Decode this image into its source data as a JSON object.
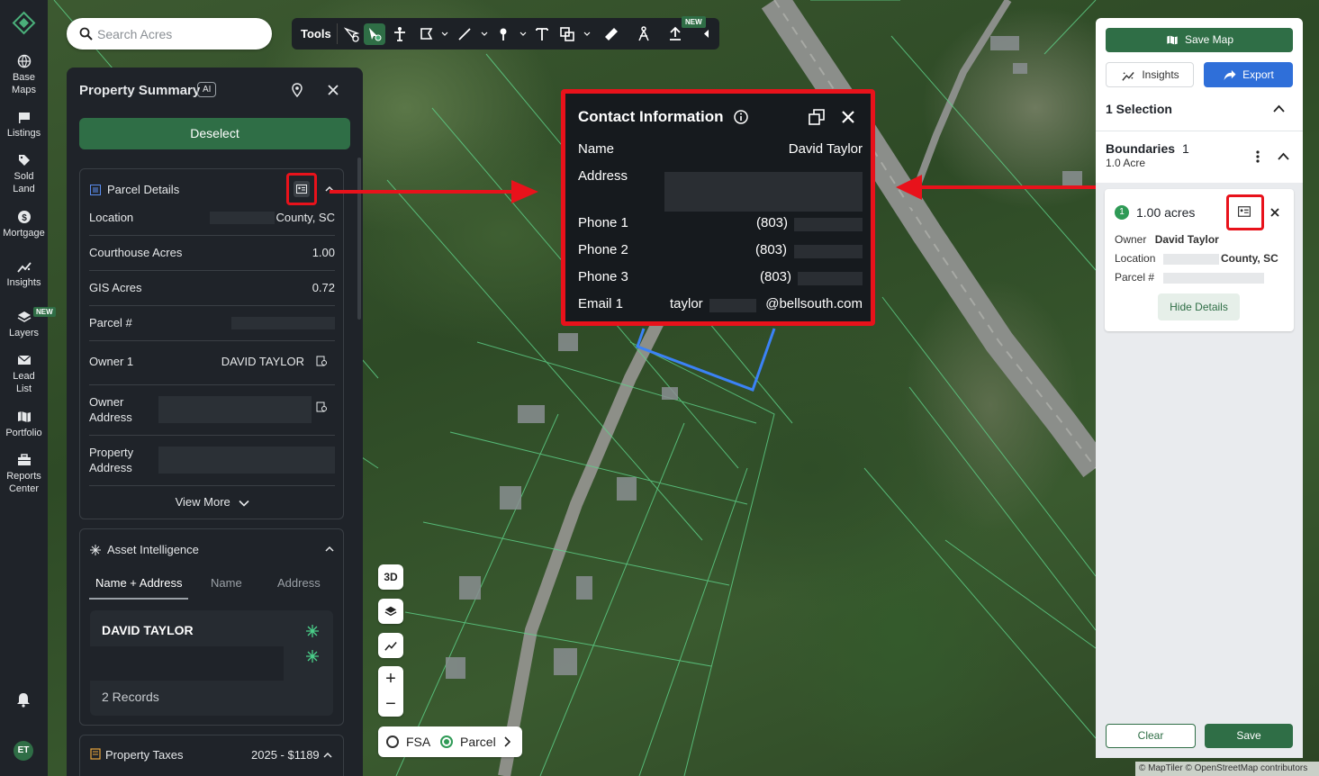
{
  "search": {
    "placeholder": "Search Acres"
  },
  "nav": {
    "items": [
      {
        "label_line1": "Base",
        "label_line2": "Maps",
        "icon": "globe-icon"
      },
      {
        "label_line1": "Listings",
        "label_line2": "",
        "icon": "flag-icon"
      },
      {
        "label_line1": "Sold",
        "label_line2": "Land",
        "icon": "tag-icon"
      },
      {
        "label_line1": "Mortgage",
        "label_line2": "",
        "icon": "dollar-icon"
      },
      {
        "label_line1": "Insights",
        "label_line2": "",
        "icon": "insights-icon"
      },
      {
        "label_line1": "Layers",
        "label_line2": "",
        "icon": "layers-icon"
      },
      {
        "label_line1": "Lead",
        "label_line2": "List",
        "icon": "mail-icon"
      },
      {
        "label_line1": "Portfolio",
        "label_line2": "",
        "icon": "map-icon"
      },
      {
        "label_line1": "Reports",
        "label_line2": "Center",
        "icon": "briefcase-icon"
      }
    ],
    "new_badge": "NEW",
    "avatar": "ET"
  },
  "tools": {
    "label": "Tools",
    "new_badge": "NEW"
  },
  "summary": {
    "title": "Property Summary",
    "ai_badge": "AI",
    "deselect": "Deselect",
    "parcel_details": {
      "heading": "Parcel Details",
      "rows": [
        {
          "key": "Location",
          "value": "County, SC"
        },
        {
          "key": "Courthouse Acres",
          "value": "1.00"
        },
        {
          "key": "GIS Acres",
          "value": "0.72"
        },
        {
          "key": "Parcel #",
          "value": ""
        },
        {
          "key": "Owner 1",
          "value": "DAVID TAYLOR"
        },
        {
          "key_line1": "Owner",
          "key_line2": "Address"
        },
        {
          "key_line1": "Property",
          "key_line2": "Address"
        }
      ],
      "view_more": "View More"
    },
    "asset": {
      "heading": "Asset Intelligence",
      "tabs": [
        "Name + Address",
        "Name",
        "Address"
      ],
      "name": "DAVID TAYLOR",
      "records": "2 Records"
    },
    "taxes": {
      "heading": "Property Taxes",
      "value": "2025 - $1189"
    }
  },
  "contact": {
    "title": "Contact Information",
    "name_label": "Name",
    "name_value": "David Taylor",
    "address_label": "Address",
    "phone1_label": "Phone 1",
    "phone1_value": "(803)",
    "phone2_label": "Phone 2",
    "phone2_value": "(803)",
    "phone3_label": "Phone 3",
    "phone3_value": "(803)",
    "email_label": "Email 1",
    "email_prefix": "taylor",
    "email_suffix": "@bellsouth.com"
  },
  "right": {
    "save_map": "Save Map",
    "insights": "Insights",
    "export": "Export",
    "selection": "1 Selection",
    "boundaries": "Boundaries",
    "boundaries_count": "1",
    "boundaries_sub": "1.0 Acre",
    "sel_number": "1",
    "sel_acres": "1.00 acres",
    "owner_label": "Owner",
    "owner_value": "David Taylor",
    "location_label": "Location",
    "location_value": "County, SC",
    "parcel_label": "Parcel #",
    "hide_details": "Hide Details",
    "clear": "Clear",
    "save": "Save"
  },
  "map": {
    "btn_3d": "3D",
    "zoom_in": "+",
    "zoom_out": "−",
    "layer_fsa": "FSA",
    "layer_parcel": "Parcel",
    "attribution": "© MapTiler © OpenStreetMap contributors"
  },
  "colors": {
    "brand_green": "#2f6e46",
    "highlight_red": "#e8121b",
    "export_blue": "#2f6fd9",
    "parcel_outline": "#3b82f6"
  }
}
